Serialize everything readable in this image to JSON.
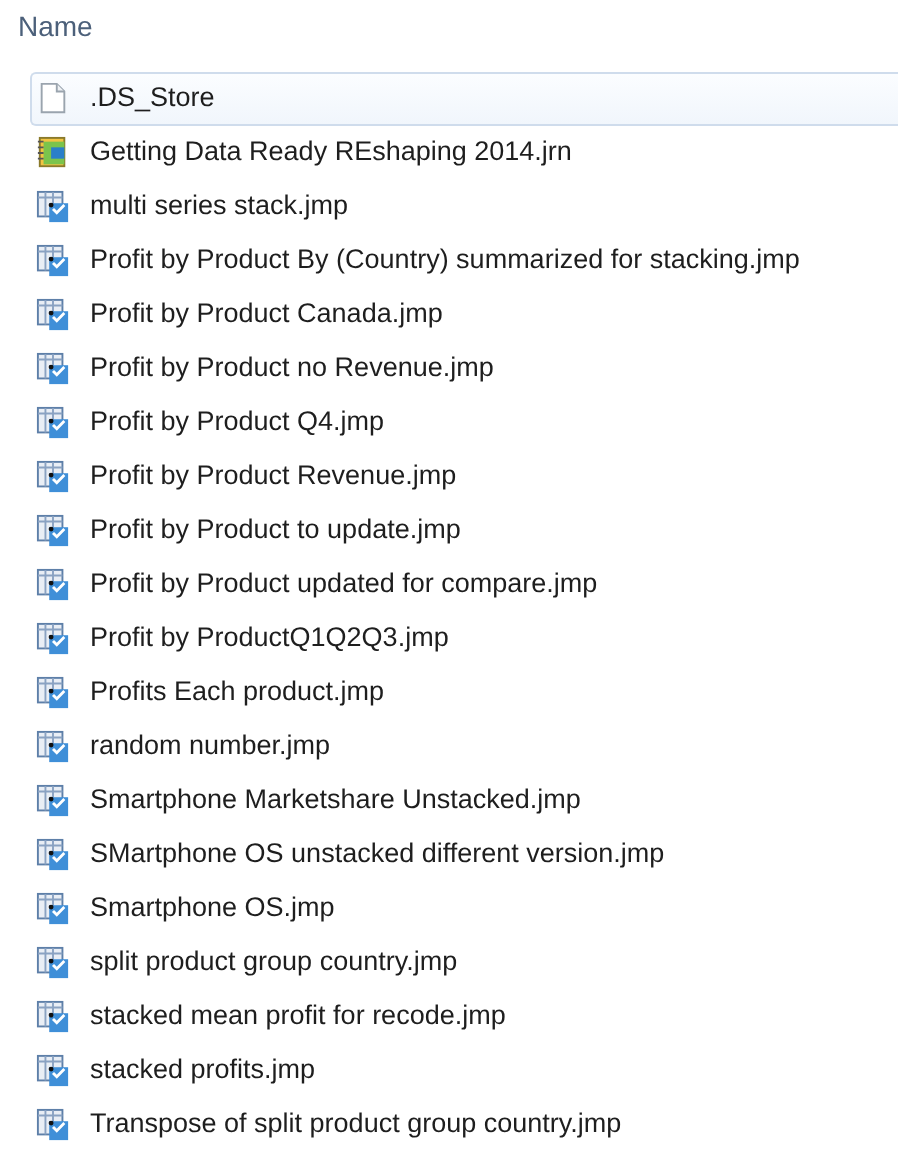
{
  "header": {
    "column_1": "Name"
  },
  "files": [
    {
      "name": ".DS_Store",
      "kind": "blank",
      "selected": true
    },
    {
      "name": "Getting Data Ready REshaping 2014.jrn",
      "kind": "journal",
      "selected": false
    },
    {
      "name": "multi series stack.jmp",
      "kind": "table",
      "selected": false
    },
    {
      "name": "Profit by Product By (Country) summarized for stacking.jmp",
      "kind": "table",
      "selected": false
    },
    {
      "name": "Profit by Product Canada.jmp",
      "kind": "table",
      "selected": false
    },
    {
      "name": "Profit by Product no Revenue.jmp",
      "kind": "table",
      "selected": false
    },
    {
      "name": "Profit by Product Q4.jmp",
      "kind": "table",
      "selected": false
    },
    {
      "name": "Profit by Product Revenue.jmp",
      "kind": "table",
      "selected": false
    },
    {
      "name": "Profit by Product to update.jmp",
      "kind": "table",
      "selected": false
    },
    {
      "name": "Profit by Product updated for compare.jmp",
      "kind": "table",
      "selected": false
    },
    {
      "name": "Profit by ProductQ1Q2Q3.jmp",
      "kind": "table",
      "selected": false
    },
    {
      "name": "Profits Each product.jmp",
      "kind": "table",
      "selected": false
    },
    {
      "name": "random number.jmp",
      "kind": "table",
      "selected": false
    },
    {
      "name": "Smartphone Marketshare Unstacked.jmp",
      "kind": "table",
      "selected": false
    },
    {
      "name": "SMartphone OS unstacked different version.jmp",
      "kind": "table",
      "selected": false
    },
    {
      "name": "Smartphone OS.jmp",
      "kind": "table",
      "selected": false
    },
    {
      "name": "split product group country.jmp",
      "kind": "table",
      "selected": false
    },
    {
      "name": "stacked mean profit for recode.jmp",
      "kind": "table",
      "selected": false
    },
    {
      "name": "stacked profits.jmp",
      "kind": "table",
      "selected": false
    },
    {
      "name": "Transpose of split product group country.jmp",
      "kind": "table",
      "selected": false
    }
  ]
}
